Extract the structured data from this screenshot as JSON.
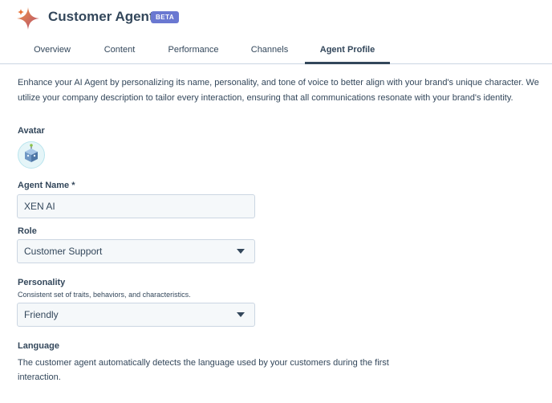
{
  "header": {
    "title": "Customer Agent",
    "badge": "BETA",
    "logo_icon": "sparkle-star-icon",
    "logo_colors": [
      "#e8743b",
      "#b24a6c"
    ]
  },
  "tabs": [
    {
      "label": "Overview",
      "active": false
    },
    {
      "label": "Content",
      "active": false
    },
    {
      "label": "Performance",
      "active": false
    },
    {
      "label": "Channels",
      "active": false
    },
    {
      "label": "Agent Profile",
      "active": true
    }
  ],
  "description": "Enhance your AI Agent by personalizing its name, personality, and tone of voice to better align with your brand's unique character. We utilize your company description to tailor every interaction, ensuring that all communications resonate with your brand's identity.",
  "avatar": {
    "label": "Avatar",
    "icon": "robot-cube-avatar-icon"
  },
  "agent_name": {
    "label": "Agent Name *",
    "value": "XEN AI"
  },
  "role": {
    "label": "Role",
    "value": "Customer Support"
  },
  "personality": {
    "label": "Personality",
    "help": "Consistent set of traits, behaviors, and characteristics.",
    "value": "Friendly"
  },
  "language": {
    "label": "Language",
    "text": "The customer agent automatically detects the language used by your customers during the first interaction."
  },
  "colors": {
    "text": "#33475b",
    "border": "#cbd6e2",
    "field_bg": "#f5f8fa",
    "badge_bg": "#6a78d1"
  }
}
